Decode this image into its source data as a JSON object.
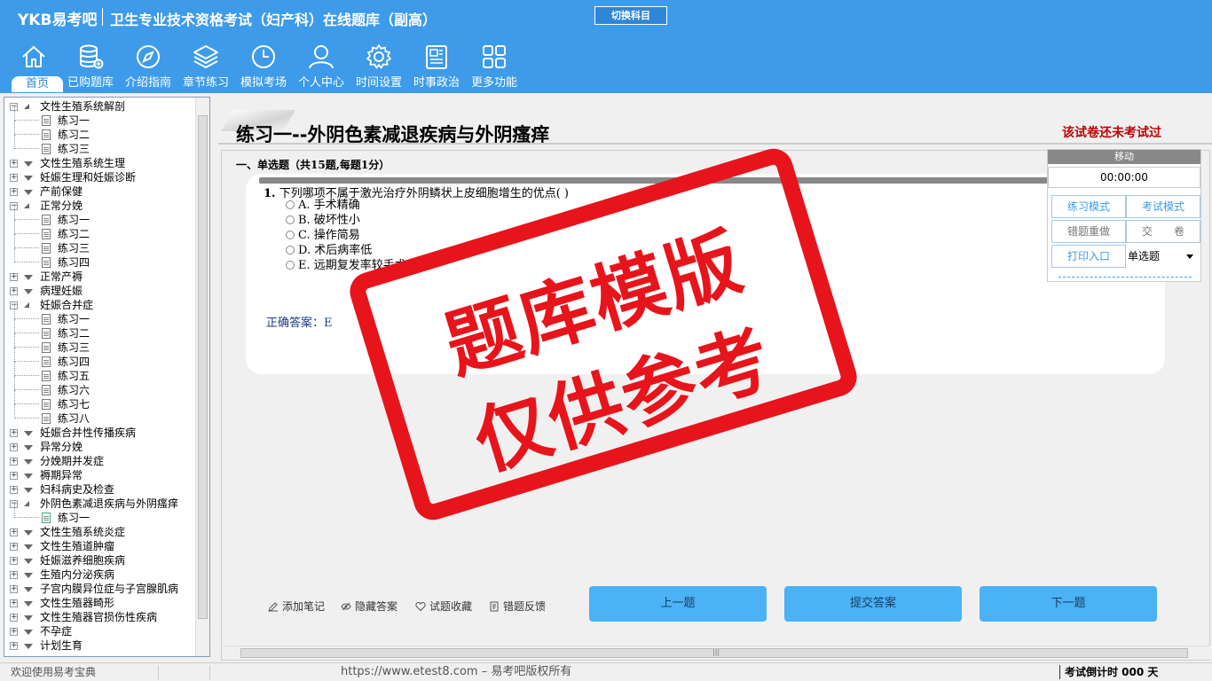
{
  "header": {
    "logo": "YKB易考吧",
    "title": "卫生专业技术资格考试（妇产科）在线题库（副高）",
    "switch_subject": "切换科目"
  },
  "nav": [
    {
      "label": "首页",
      "icon": "home-icon",
      "active": true
    },
    {
      "label": "已购题库",
      "icon": "database-icon"
    },
    {
      "label": "介绍指南",
      "icon": "compass-icon"
    },
    {
      "label": "章节练习",
      "icon": "layers-icon"
    },
    {
      "label": "模拟考场",
      "icon": "clock-icon"
    },
    {
      "label": "个人中心",
      "icon": "user-icon"
    },
    {
      "label": "时间设置",
      "icon": "gear-icon"
    },
    {
      "label": "时事政治",
      "icon": "news-icon"
    },
    {
      "label": "更多功能",
      "icon": "grid-icon"
    }
  ],
  "tree": [
    {
      "label": "文性生殖系统解剖",
      "level": 0,
      "state": "open"
    },
    {
      "label": "练习一",
      "level": 1
    },
    {
      "label": "练习二",
      "level": 1
    },
    {
      "label": "练习三",
      "level": 1
    },
    {
      "label": "文性生殖系统生理",
      "level": 0,
      "state": "closed"
    },
    {
      "label": "妊娠生理和妊娠诊断",
      "level": 0,
      "state": "closed"
    },
    {
      "label": "产前保健",
      "level": 0,
      "state": "closed"
    },
    {
      "label": "正常分娩",
      "level": 0,
      "state": "open"
    },
    {
      "label": "练习一",
      "level": 1
    },
    {
      "label": "练习二",
      "level": 1
    },
    {
      "label": "练习三",
      "level": 1
    },
    {
      "label": "练习四",
      "level": 1
    },
    {
      "label": "正常产褥",
      "level": 0,
      "state": "closed"
    },
    {
      "label": "病理妊娠",
      "level": 0,
      "state": "closed"
    },
    {
      "label": "妊娠合并症",
      "level": 0,
      "state": "open"
    },
    {
      "label": "练习一",
      "level": 1
    },
    {
      "label": "练习二",
      "level": 1
    },
    {
      "label": "练习三",
      "level": 1
    },
    {
      "label": "练习四",
      "level": 1
    },
    {
      "label": "练习五",
      "level": 1
    },
    {
      "label": "练习六",
      "level": 1
    },
    {
      "label": "练习七",
      "level": 1
    },
    {
      "label": "练习八",
      "level": 1
    },
    {
      "label": "妊娠合并性传播疾病",
      "level": 0,
      "state": "closed"
    },
    {
      "label": "异常分娩",
      "level": 0,
      "state": "closed"
    },
    {
      "label": "分娩期并发症",
      "level": 0,
      "state": "closed"
    },
    {
      "label": "褥期异常",
      "level": 0,
      "state": "closed"
    },
    {
      "label": "妇科病史及检查",
      "level": 0,
      "state": "closed"
    },
    {
      "label": "外阴色素减退疾病与外阴瘙痒",
      "level": 0,
      "state": "open"
    },
    {
      "label": "练习一",
      "level": 1,
      "current": true
    },
    {
      "label": "文性生殖系统炎症",
      "level": 0,
      "state": "closed"
    },
    {
      "label": "文性生殖道肿瘤",
      "level": 0,
      "state": "closed"
    },
    {
      "label": "妊娠滋养细胞疾病",
      "level": 0,
      "state": "closed"
    },
    {
      "label": "生殖内分泌疾病",
      "level": 0,
      "state": "closed"
    },
    {
      "label": "子宫内膜异位症与子宫腺肌病",
      "level": 0,
      "state": "closed"
    },
    {
      "label": "文性生殖器畸形",
      "level": 0,
      "state": "closed"
    },
    {
      "label": "文性生殖器官损伤性疾病",
      "level": 0,
      "state": "closed"
    },
    {
      "label": "不孕症",
      "level": 0,
      "state": "closed"
    },
    {
      "label": "计划生育",
      "level": 0,
      "state": "closed"
    }
  ],
  "paper": {
    "title": "练习一--外阴色素减退疾病与外阴瘙痒",
    "status": "该试卷还未考试过",
    "section": "一、单选题（共15题,每题1分）"
  },
  "question": {
    "number": "1.",
    "text": "下列哪项不属于激光治疗外阴鳞状上皮细胞增生的优点( )",
    "options": [
      "A. 手术精确",
      "B. 破坏性小",
      "C. 操作简易",
      "D. 术后病率低",
      "E. 远期复发率较手术低"
    ],
    "answer_label": "正确答案：",
    "answer_value": "E"
  },
  "control": {
    "move": "移动",
    "timer": "00:00:00",
    "practice_mode": "练习模式",
    "exam_mode": "考试模式",
    "redo_wrong": "错题重做",
    "submit_paper": "交　　卷",
    "print_entry": "打印入口",
    "question_type": "单选题"
  },
  "tools": {
    "add_note": "添加笔记",
    "hide_answer": "隐藏答案",
    "favorite": "试题收藏",
    "feedback": "错题反馈"
  },
  "buttons": {
    "prev": "上一题",
    "submit": "提交答案",
    "next": "下一题"
  },
  "statusbar": {
    "welcome": "欢迎使用易考宝典",
    "url": "https://www.etest8.com – 易考吧版权所有",
    "countdown": "考试倒计时 000 天"
  },
  "watermark": {
    "line1": "题库模版",
    "line2": "仅供参考"
  },
  "colors": {
    "header": "#3d9be9",
    "stamp": "#e8141b",
    "button": "#4ab2f5",
    "status_red": "#c00000"
  }
}
